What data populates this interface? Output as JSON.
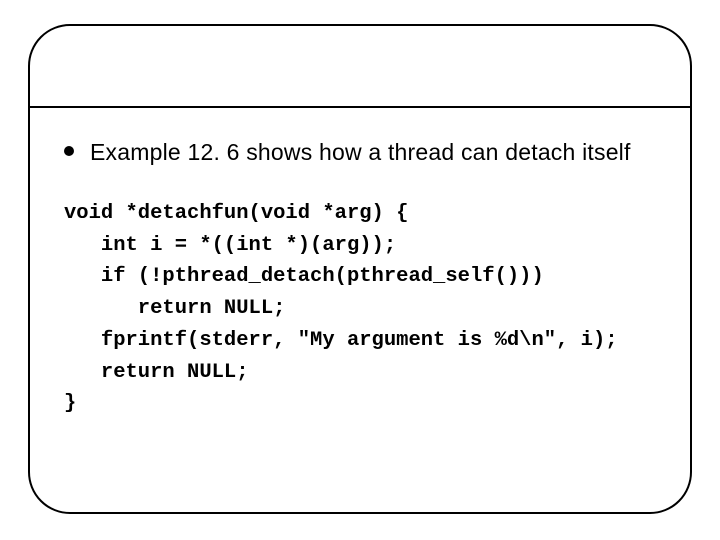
{
  "bullet": {
    "text": "Example 12. 6 shows how a thread can detach itself"
  },
  "code": {
    "l0": "void *detachfun(void *arg) {",
    "l1": "   int i = *((int *)(arg));",
    "l2": "   if (!pthread_detach(pthread_self()))",
    "l3": "      return NULL;",
    "l4": "   fprintf(stderr, \"My argument is %d\\n\", i);",
    "l5": "   return NULL;",
    "l6": "}"
  }
}
